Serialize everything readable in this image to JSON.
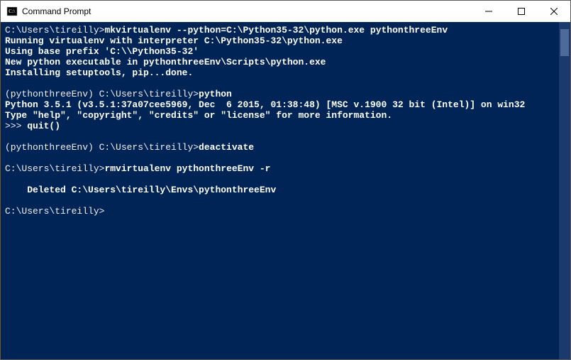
{
  "window": {
    "title": "Command Prompt"
  },
  "scrollbar": {
    "thumb_top_pct": 2,
    "thumb_height_pct": 8
  },
  "terminal": {
    "lines": [
      {
        "segments": [
          {
            "t": "C:\\Users\\tireilly>",
            "bold": false
          },
          {
            "t": "mkvirtualenv --python=C:\\Python35-32\\python.exe pythonthreeEnv",
            "bold": true
          }
        ]
      },
      {
        "segments": [
          {
            "t": "Running virtualenv with interpreter C:\\Python35-32\\python.exe",
            "bold": true
          }
        ]
      },
      {
        "segments": [
          {
            "t": "Using base prefix 'C:\\\\Python35-32'",
            "bold": true
          }
        ]
      },
      {
        "segments": [
          {
            "t": "New python executable in pythonthreeEnv\\Scripts\\python.exe",
            "bold": true
          }
        ]
      },
      {
        "segments": [
          {
            "t": "Installing setuptools, pip...done.",
            "bold": true
          }
        ]
      },
      {
        "segments": [
          {
            "t": "",
            "bold": false
          }
        ]
      },
      {
        "segments": [
          {
            "t": "(pythonthreeEnv) C:\\Users\\tireilly>",
            "bold": false
          },
          {
            "t": "python",
            "bold": true
          }
        ]
      },
      {
        "segments": [
          {
            "t": "Python 3.5.1 (v3.5.1:37a07cee5969, Dec  6 2015, 01:38:48) [MSC v.1900 32 bit (Intel)] on win32",
            "bold": true
          }
        ]
      },
      {
        "segments": [
          {
            "t": "Type \"help\", \"copyright\", \"credits\" or \"license\" for more information.",
            "bold": true
          }
        ]
      },
      {
        "segments": [
          {
            "t": ">>> ",
            "bold": false
          },
          {
            "t": "quit()",
            "bold": true
          }
        ]
      },
      {
        "segments": [
          {
            "t": "",
            "bold": false
          }
        ]
      },
      {
        "segments": [
          {
            "t": "(pythonthreeEnv) C:\\Users\\tireilly>",
            "bold": false
          },
          {
            "t": "deactivate",
            "bold": true
          }
        ]
      },
      {
        "segments": [
          {
            "t": "",
            "bold": false
          }
        ]
      },
      {
        "segments": [
          {
            "t": "C:\\Users\\tireilly>",
            "bold": false
          },
          {
            "t": "rmvirtualenv pythonthreeEnv -r",
            "bold": true
          }
        ]
      },
      {
        "segments": [
          {
            "t": "",
            "bold": false
          }
        ]
      },
      {
        "segments": [
          {
            "t": "    Deleted C:\\Users\\tireilly\\Envs\\pythonthreeEnv",
            "bold": true
          }
        ]
      },
      {
        "segments": [
          {
            "t": "",
            "bold": false
          }
        ]
      },
      {
        "segments": [
          {
            "t": "C:\\Users\\tireilly>",
            "bold": false
          }
        ]
      }
    ]
  }
}
